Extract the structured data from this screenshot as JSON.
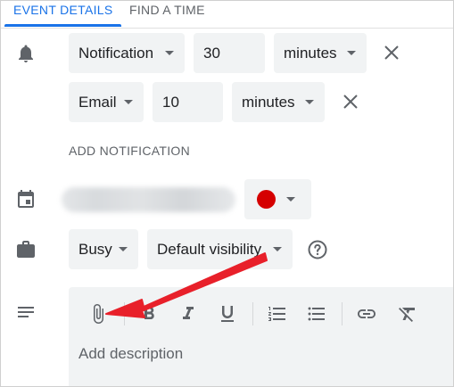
{
  "tabs": {
    "event_details": "EVENT DETAILS",
    "find_a_time": "FIND A TIME"
  },
  "notifications": [
    {
      "method": "Notification",
      "amount": "30",
      "unit": "minutes"
    },
    {
      "method": "Email",
      "amount": "10",
      "unit": "minutes"
    }
  ],
  "add_notification_label": "ADD NOTIFICATION",
  "calendar": {
    "color": "#d50000"
  },
  "availability": {
    "status": "Busy",
    "visibility": "Default visibility"
  },
  "description": {
    "placeholder": "Add description"
  },
  "colors": {
    "accent": "#1a73e8",
    "annotation_arrow": "#e8202a"
  }
}
